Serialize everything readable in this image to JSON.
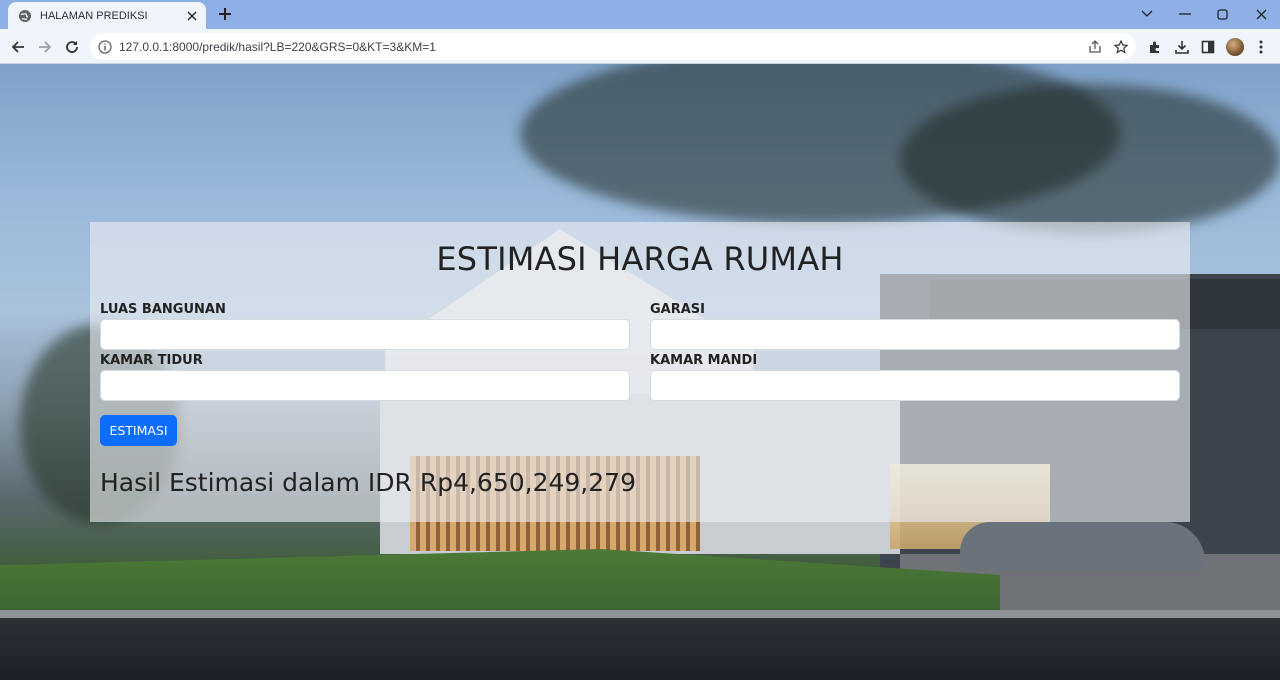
{
  "browser": {
    "tab_title": "HALAMAN PREDIKSI",
    "url": "127.0.0.1:8000/predik/hasil?LB=220&GRS=0&KT=3&KM=1",
    "icons": [
      "globe-icon",
      "close-icon",
      "plus-icon",
      "chevron-down-icon",
      "minimize-icon",
      "maximize-icon",
      "window-close-icon",
      "back-icon",
      "forward-icon",
      "reload-icon",
      "info-icon",
      "share-icon",
      "star-icon",
      "extensions-icon",
      "download-icon",
      "side-panel-icon",
      "avatar",
      "kebab-menu-icon"
    ]
  },
  "form": {
    "title": "ESTIMASI HARGA RUMAH",
    "fields": [
      {
        "label": "LUAS BANGUNAN",
        "value": ""
      },
      {
        "label": "GARASI",
        "value": ""
      },
      {
        "label": "KAMAR TIDUR",
        "value": ""
      },
      {
        "label": "KAMAR MANDI",
        "value": ""
      }
    ],
    "submit_label": "ESTIMASI",
    "result_text": "Hasil Estimasi dalam IDR Rp4,650,249,279"
  },
  "colors": {
    "button": "#0d6efd",
    "tabbar": "#8fb0e6",
    "toolbar": "#f0f4fb"
  }
}
